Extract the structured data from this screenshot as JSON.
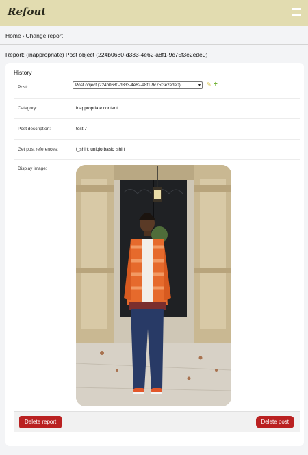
{
  "app": {
    "logo_text": "Refout",
    "menu_icon": "hamburger-icon"
  },
  "breadcrumb": {
    "home": "Home",
    "separator": "›",
    "current": "Change report"
  },
  "page": {
    "title": "Report: (inappropriate) Post object (224b0680-d333-4e62-a8f1-9c75f3e2ede0)"
  },
  "history": {
    "label": "History"
  },
  "fields": {
    "post": {
      "label": "Post:",
      "selected": "Post object (224b0680-d333-4e62-a8f1-9c75f3e2ede0)",
      "edit_icon": "pencil-icon",
      "add_icon": "plus-icon"
    },
    "category": {
      "label": "Category:",
      "value": "inappropriate content"
    },
    "description": {
      "label": "Post description:",
      "value": "test 7"
    },
    "references": {
      "label": "Get post references:",
      "value": "t_shirt: uniqlo basic tshirt"
    },
    "image": {
      "label": "Display image:"
    }
  },
  "actions": {
    "delete_report": "Delete report",
    "delete_post": "Delete post"
  },
  "colors": {
    "topbar": "#e2dcb0",
    "danger": "#ba2121",
    "accent_pencil": "#d8c34a",
    "accent_plus": "#74b43a"
  }
}
